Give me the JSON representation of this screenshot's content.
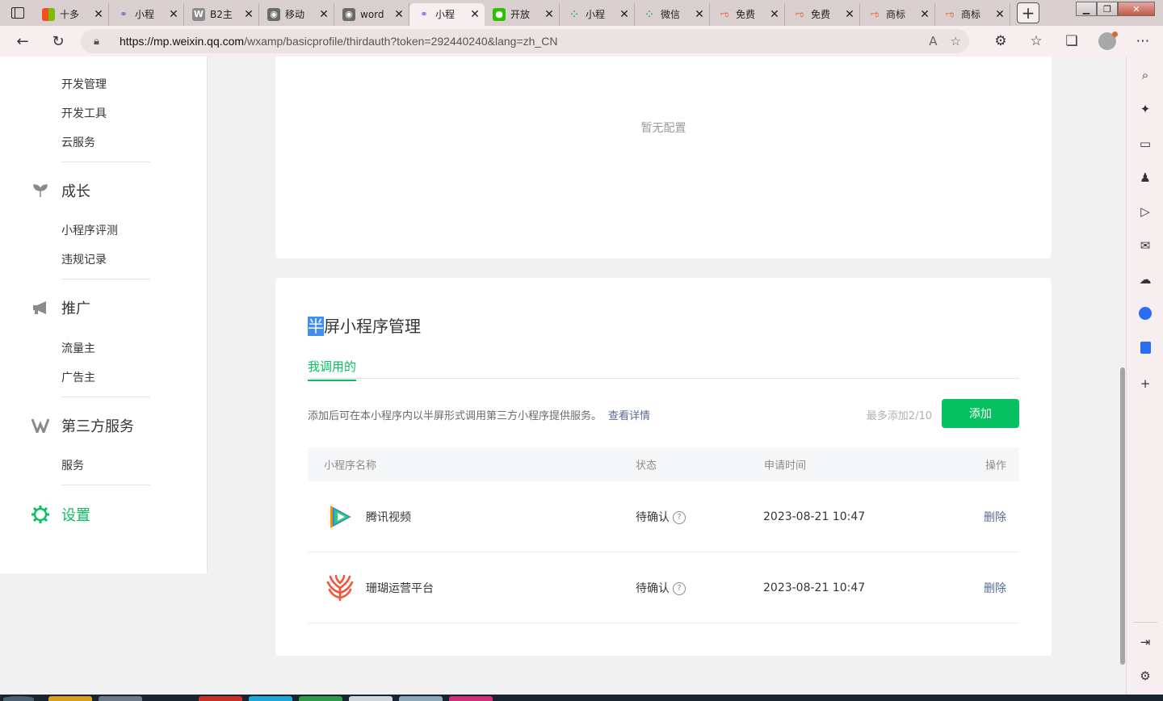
{
  "tabs": [
    {
      "label": "十多",
      "favicon": "microsoft-logo",
      "active": false
    },
    {
      "label": "小程",
      "favicon": "miniprogram-icon",
      "active": false
    },
    {
      "label": "B2主",
      "favicon": "wordpress-icon",
      "active": false
    },
    {
      "label": "移动",
      "favicon": "github-icon",
      "active": false
    },
    {
      "label": "word",
      "favicon": "github-icon",
      "active": false
    },
    {
      "label": "小程",
      "favicon": "miniprogram-icon",
      "active": true
    },
    {
      "label": "开放",
      "favicon": "wechat-icon",
      "active": false
    },
    {
      "label": "小程",
      "favicon": "dots-grid-icon",
      "active": false
    },
    {
      "label": "微信",
      "favicon": "dots-grid-icon",
      "active": false
    },
    {
      "label": "免费",
      "favicon": "logo-icon",
      "active": false
    },
    {
      "label": "免费",
      "favicon": "logo-icon",
      "active": false
    },
    {
      "label": "商标",
      "favicon": "logo-icon",
      "active": false
    },
    {
      "label": "商标",
      "favicon": "logo-icon",
      "active": false
    }
  ],
  "addressbar": {
    "url_host": "https://mp.weixin.qq.com",
    "url_path": "/wxamp/basicprofile/thirdauth?token=292440240&lang=zh_CN"
  },
  "sidebar": {
    "dev_items": [
      "开发管理",
      "开发工具",
      "云服务"
    ],
    "growth": {
      "label": "成长",
      "items": [
        "小程序评测",
        "违规记录"
      ]
    },
    "promote": {
      "label": "推广",
      "items": [
        "流量主",
        "广告主"
      ]
    },
    "third_party": {
      "label": "第三方服务",
      "items": [
        "服务"
      ]
    },
    "settings": {
      "label": "设置"
    }
  },
  "config_card": {
    "empty_text": "暂无配置"
  },
  "halfscreen": {
    "title_selected": "半",
    "title_rest": "屏小程序管理",
    "subtab": "我调用的",
    "description": "添加后可在本小程序内以半屏形式调用第三方小程序提供服务。",
    "details_link": "查看详情",
    "limit_text": "最多添加2/10",
    "add_button": "添加",
    "columns": [
      "小程序名称",
      "状态",
      "申请时间",
      "操作"
    ],
    "rows": [
      {
        "name": "腾讯视频",
        "status": "待确认",
        "time": "2023-08-21 10:47",
        "action": "删除",
        "logo": "tencent-video-logo"
      },
      {
        "name": "珊瑚运营平台",
        "status": "待确认",
        "time": "2023-08-21 10:47",
        "action": "删除",
        "logo": "coral-logo"
      }
    ]
  },
  "colors": {
    "accent": "#07c160",
    "link": "#576b95"
  }
}
